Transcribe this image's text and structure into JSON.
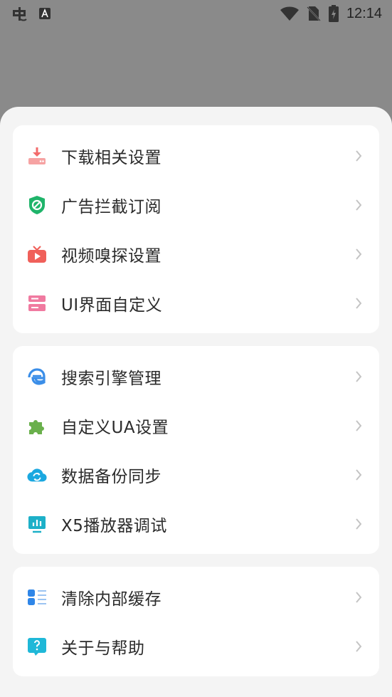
{
  "status_bar": {
    "time": "12:14",
    "left_icons": [
      "app-logo-icon",
      "keyboard-a-icon"
    ],
    "right_icons": [
      "wifi-icon",
      "no-sim-icon",
      "battery-charging-icon"
    ]
  },
  "menu": {
    "groups": [
      {
        "items": [
          {
            "label": "下载相关设置",
            "icon": "download-icon",
            "color": "#f36b6b"
          },
          {
            "label": "广告拦截订阅",
            "icon": "ad-block-shield-icon",
            "color": "#1fb46a"
          },
          {
            "label": "视频嗅探设置",
            "icon": "tv-icon",
            "color": "#f0605a"
          },
          {
            "label": "UI界面自定义",
            "icon": "ui-layout-icon",
            "color": "#f07aa0"
          }
        ]
      },
      {
        "items": [
          {
            "label": "搜索引擎管理",
            "icon": "browser-e-icon",
            "color": "#3b8ee8"
          },
          {
            "label": "自定义UA设置",
            "icon": "puzzle-icon",
            "color": "#6ab04c"
          },
          {
            "label": "数据备份同步",
            "icon": "cloud-sync-icon",
            "color": "#1ba8e0"
          },
          {
            "label": "X5播放器调试",
            "icon": "monitor-chart-icon",
            "color": "#1db0c8"
          }
        ]
      },
      {
        "items": [
          {
            "label": "清除内部缓存",
            "icon": "list-cache-icon",
            "color": "#2f86e8"
          },
          {
            "label": "关于与帮助",
            "icon": "help-bubble-icon",
            "color": "#1fb8d8"
          }
        ]
      }
    ]
  }
}
